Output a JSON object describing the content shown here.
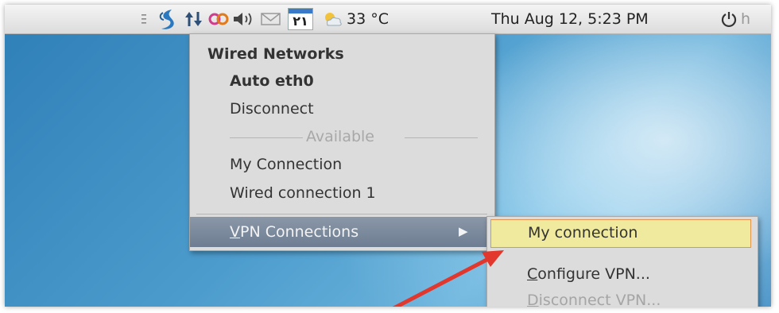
{
  "panel": {
    "calendar_day": "٢١",
    "temperature": "33 °C",
    "datetime": "Thu Aug 12,  5:23 PM",
    "power_trailing": "h"
  },
  "network_menu": {
    "wired_header": "Wired Networks",
    "active_connection": "Auto eth0",
    "disconnect": "Disconnect",
    "available_label": "Available",
    "connections": [
      "My Connection",
      "Wired connection 1"
    ],
    "vpn_connections": {
      "mnemonic": "V",
      "rest": "PN Connections"
    }
  },
  "vpn_submenu": {
    "my_connection": "My connection",
    "configure": {
      "mnemonic": "C",
      "rest": "onfigure VPN..."
    },
    "disconnect": {
      "mnemonic": "D",
      "rest": "isconnect VPN..."
    }
  },
  "colors": {
    "highlight_fill": "#f0ea9e",
    "highlight_border": "#e29550",
    "annotation_arrow": "#e2372c",
    "menu_bg": "#dcdcdc",
    "selected_row": "#7b899c"
  },
  "icons": [
    "handle-icon",
    "app-logo-icon",
    "network-arrows-icon",
    "chat-icon",
    "volume-icon",
    "mail-icon",
    "calendar-icon",
    "weather-icon",
    "power-icon"
  ]
}
